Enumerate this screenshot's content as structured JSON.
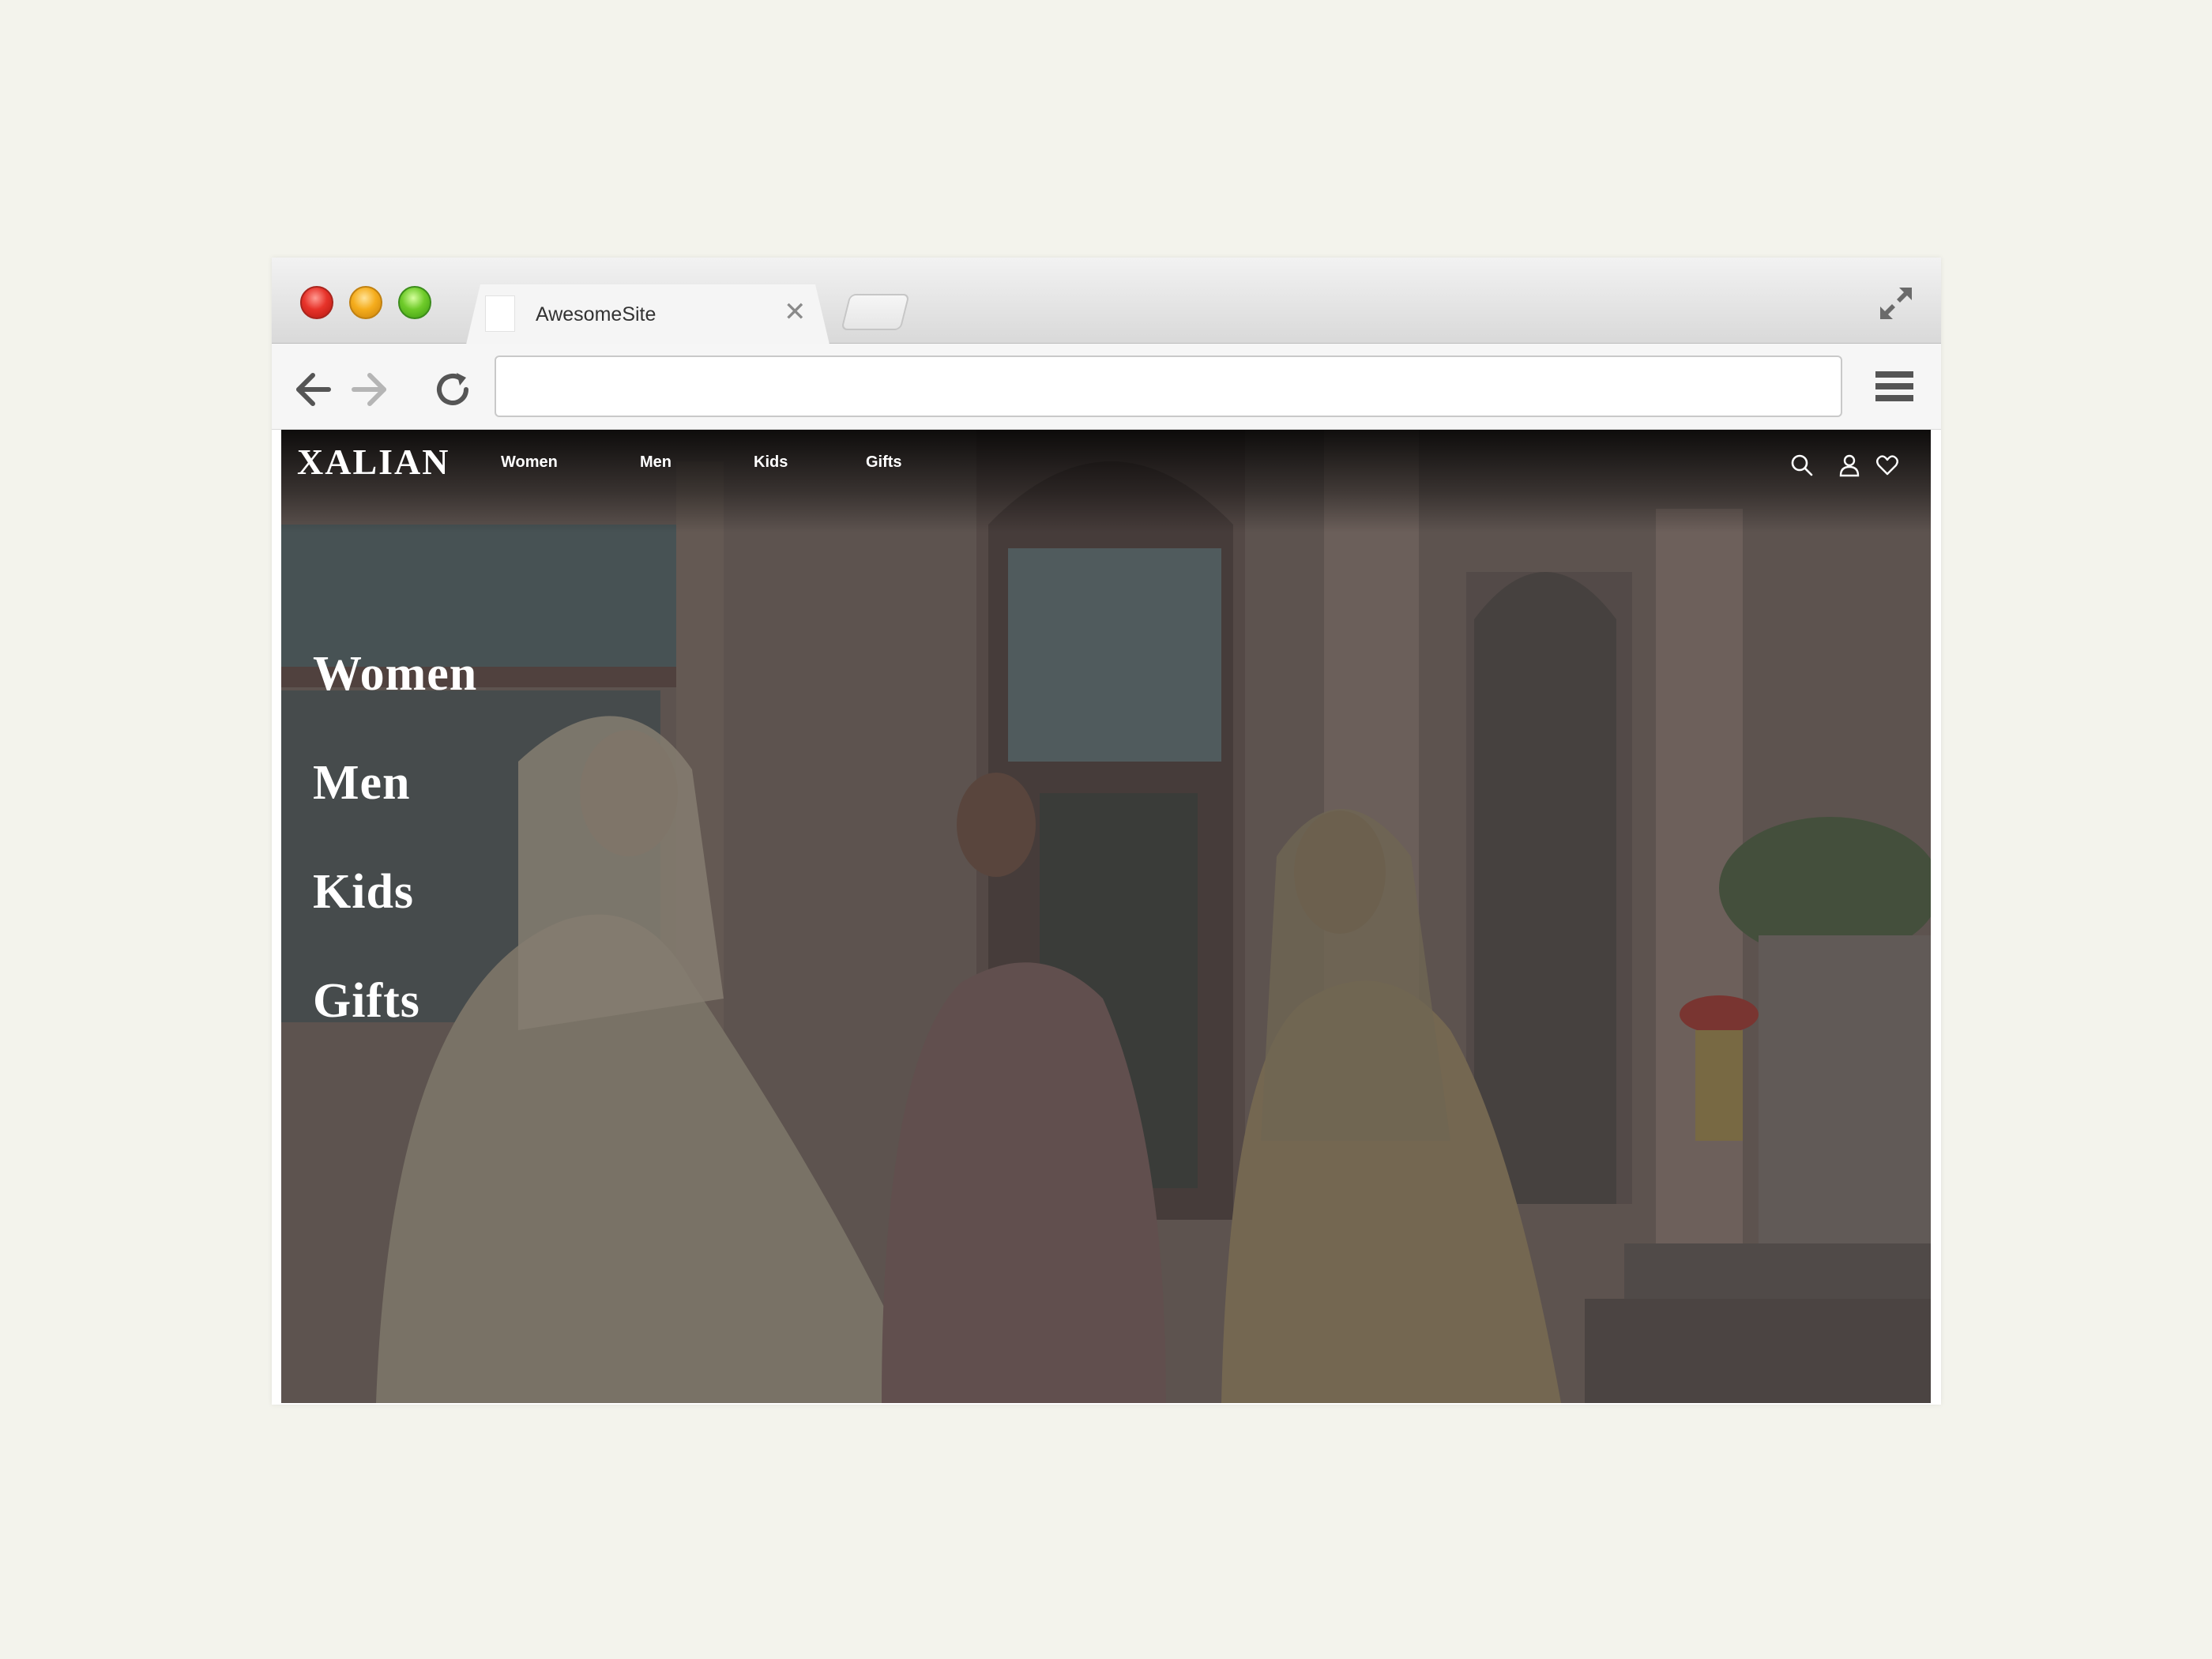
{
  "browser": {
    "tab_title": "AwesomeSite",
    "url": ""
  },
  "site": {
    "logo": "XALIAN",
    "top_nav": [
      "Women",
      "Men",
      "Kids",
      "Gifts"
    ],
    "hero_nav": [
      "Women",
      "Men",
      "Kids",
      "Gifts"
    ],
    "icons": [
      "search-icon",
      "user-icon",
      "heart-icon"
    ]
  },
  "colors": {
    "page_background": "#f3f3ec",
    "nav_text": "#ffffff"
  }
}
